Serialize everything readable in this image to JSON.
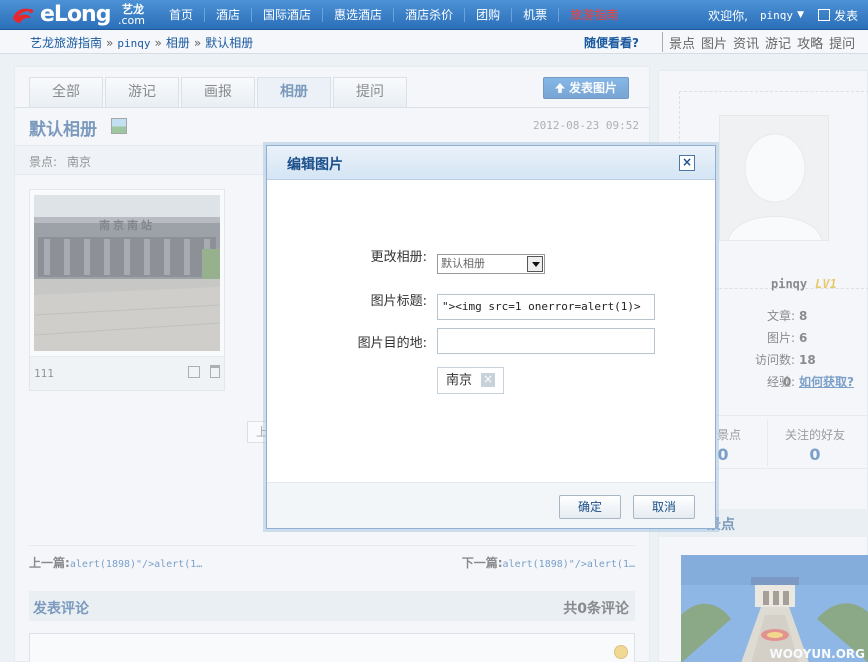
{
  "topbar": {
    "logo": {
      "word": "eLong",
      "cn": "艺龙",
      "com": ".com"
    },
    "nav": [
      "首页",
      "酒店",
      "国际酒店",
      "惠选酒店",
      "酒店杀价",
      "团购",
      "机票",
      "旅游指南"
    ],
    "welcome": "欢迎你,",
    "user": "pinqy",
    "post": "发表"
  },
  "breadcrumb": {
    "items": [
      "艺龙旅游指南",
      "pinqy",
      "相册",
      "默认相册"
    ],
    "random": "随便看看?",
    "right_tabs": [
      "景点",
      "图片",
      "资讯",
      "游记",
      "攻略",
      "提问"
    ]
  },
  "main": {
    "tabs": [
      "全部",
      "游记",
      "画报",
      "相册",
      "提问"
    ],
    "upload_label": "发表图片",
    "album_title": "默认相册",
    "album_date": "2012-08-23 09:52",
    "scenic_label": "景点:",
    "scenic_value": "南京",
    "photo": {
      "sign": "南京南站",
      "name": "111"
    },
    "pager_ghost": "上",
    "prev_label": "上一篇:",
    "prev_link": "alert(1898)\"/>alert(1…",
    "next_label": "下一篇:",
    "next_link": "alert(1898)\"/>alert(1…",
    "comment_title": "发表评论",
    "comment_count": "共0条评论"
  },
  "side": {
    "username": "pinqy",
    "level": "LV1",
    "stats": [
      {
        "label": "文章:",
        "value": "8"
      },
      {
        "label": "图片:",
        "value": "6"
      },
      {
        "label": "访问数:",
        "value": "18"
      },
      {
        "label": "经验:",
        "value": "0",
        "link": "如何获取?"
      }
    ],
    "follow": [
      {
        "label": "的景点",
        "value": "0"
      },
      {
        "label": "关注的好友",
        "value": "0"
      }
    ],
    "section_title": "景点",
    "watermark": "WOOYUN.ORG"
  },
  "dialog": {
    "title": "编辑图片",
    "close": "×",
    "album_label": "更改相册:",
    "album_value": "默认相册",
    "title_label": "图片标题:",
    "title_value": "\"><img src=1 onerror=alert(1)>",
    "dest_label": "图片目的地:",
    "dest_value": "",
    "tag": "南京",
    "tag_remove": "×",
    "ok": "确定",
    "cancel": "取消"
  },
  "colors": {
    "nav_bg": "#2a6fb8",
    "accent": "#1b4f8a",
    "active_nav": "#ff3b2f"
  }
}
